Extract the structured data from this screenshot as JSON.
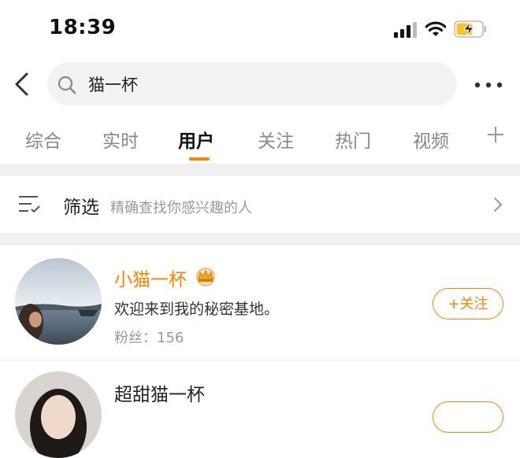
{
  "status_bar": {
    "time": "18:39"
  },
  "search": {
    "query": "猫一杯"
  },
  "tabs": [
    {
      "label": "综合",
      "active": false
    },
    {
      "label": "实时",
      "active": false
    },
    {
      "label": "用户",
      "active": true
    },
    {
      "label": "关注",
      "active": false
    },
    {
      "label": "热门",
      "active": false
    },
    {
      "label": "视频",
      "active": false
    }
  ],
  "filter": {
    "label": "筛选",
    "description": "精确查找你感兴趣的人"
  },
  "users": [
    {
      "name": "小猫一杯",
      "bio": "欢迎来到我的秘密基地。",
      "fans_label": "粉丝：",
      "fans_count": "156",
      "follow_label": "+关注",
      "name_color": "#ff8200",
      "badge": "crown-badge"
    },
    {
      "name": "超甜猫一杯",
      "name_color": "#222"
    }
  ],
  "colors": {
    "accent": "#ff8200",
    "text": "#222",
    "muted": "#999",
    "separator": "#f0f0f0"
  }
}
